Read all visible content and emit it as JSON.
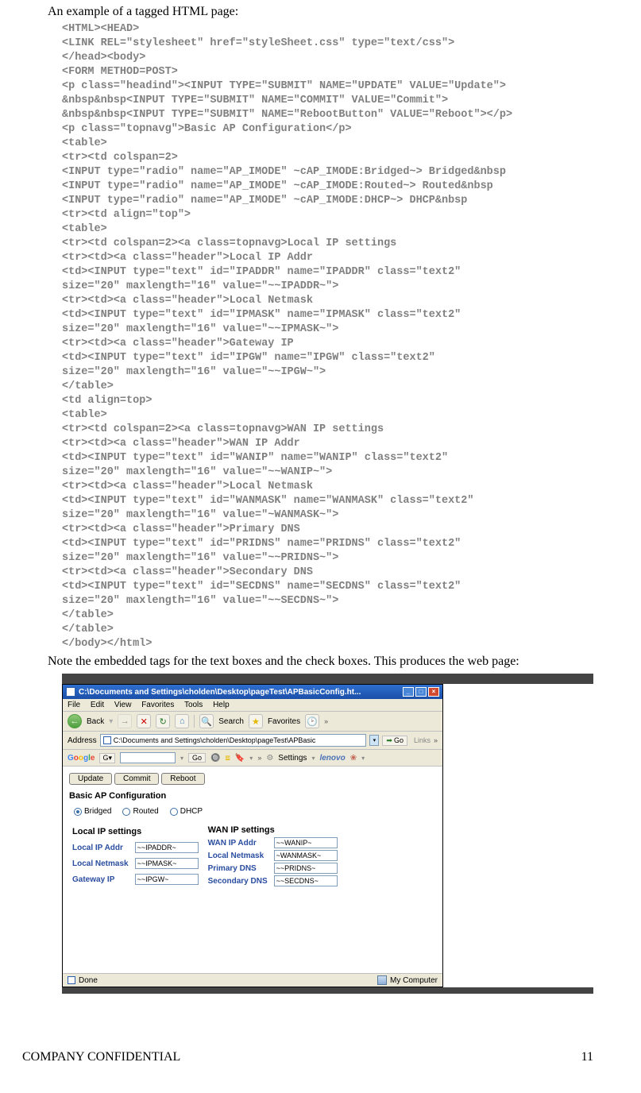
{
  "intro": "An example of a tagged HTML page:",
  "code": "<HTML><HEAD>\n<LINK REL=\"stylesheet\" href=\"styleSheet.css\" type=\"text/css\">\n</head><body>\n<FORM METHOD=POST>\n<p class=\"headind\"><INPUT TYPE=\"SUBMIT\" NAME=\"UPDATE\" VALUE=\"Update\">\n&nbsp&nbsp<INPUT TYPE=\"SUBMIT\" NAME=\"COMMIT\" VALUE=\"Commit\">\n&nbsp&nbsp<INPUT TYPE=\"SUBMIT\" NAME=\"RebootButton\" VALUE=\"Reboot\"></p>\n<p class=\"topnavg\">Basic AP Configuration</p>\n<table>\n<tr><td colspan=2>\n<INPUT type=\"radio\" name=\"AP_IMODE\" ~cAP_IMODE:Bridged~> Bridged&nbsp\n<INPUT type=\"radio\" name=\"AP_IMODE\" ~cAP_IMODE:Routed~> Routed&nbsp\n<INPUT type=\"radio\" name=\"AP_IMODE\" ~cAP_IMODE:DHCP~> DHCP&nbsp\n<tr><td align=\"top\">\n<table>\n<tr><td colspan=2><a class=topnavg>Local IP settings\n<tr><td><a class=\"header\">Local IP Addr\n<td><INPUT type=\"text\" id=\"IPADDR\" name=\"IPADDR\" class=\"text2\"\nsize=\"20\" maxlength=\"16\" value=\"~~IPADDR~\">\n<tr><td><a class=\"header\">Local Netmask\n<td><INPUT type=\"text\" id=\"IPMASK\" name=\"IPMASK\" class=\"text2\"\nsize=\"20\" maxlength=\"16\" value=\"~~IPMASK~\">\n<tr><td><a class=\"header\">Gateway IP\n<td><INPUT type=\"text\" id=\"IPGW\" name=\"IPGW\" class=\"text2\"\nsize=\"20\" maxlength=\"16\" value=\"~~IPGW~\">\n</table>\n<td align=top>\n<table>\n<tr><td colspan=2><a class=topnavg>WAN IP settings\n<tr><td><a class=\"header\">WAN IP Addr\n<td><INPUT type=\"text\" id=\"WANIP\" name=\"WANIP\" class=\"text2\"\nsize=\"20\" maxlength=\"16\" value=\"~~WANIP~\">\n<tr><td><a class=\"header\">Local Netmask\n<td><INPUT type=\"text\" id=\"WANMASK\" name=\"WANMASK\" class=\"text2\"\nsize=\"20\" maxlength=\"16\" value=\"~WANMASK~\">\n<tr><td><a class=\"header\">Primary DNS\n<td><INPUT type=\"text\" id=\"PRIDNS\" name=\"PRIDNS\" class=\"text2\"\nsize=\"20\" maxlength=\"16\" value=\"~~PRIDNS~\">\n<tr><td><a class=\"header\">Secondary DNS\n<td><INPUT type=\"text\" id=\"SECDNS\" name=\"SECDNS\" class=\"text2\"\nsize=\"20\" maxlength=\"16\" value=\"~~SECDNS~\">\n</table>\n</table>\n</body></html>",
  "note": "Note the embedded tags for the text boxes and the check boxes. This produces the web page:",
  "browser": {
    "title": "C:\\Documents and Settings\\cholden\\Desktop\\pageTest\\APBasicConfig.ht...",
    "menu": [
      "File",
      "Edit",
      "View",
      "Favorites",
      "Tools",
      "Help"
    ],
    "toolbar": {
      "back": "Back",
      "search": "Search",
      "favorites": "Favorites"
    },
    "address_label": "Address",
    "address": "C:\\Documents and Settings\\cholden\\Desktop\\pageTest\\APBasic",
    "go": "Go",
    "links": "Links",
    "google": {
      "label": "Google",
      "go": "Go",
      "settings": "Settings",
      "brand": "lenovo"
    },
    "page": {
      "buttons": {
        "update": "Update",
        "commit": "Commit",
        "reboot": "Reboot"
      },
      "heading": "Basic AP Configuration",
      "radios": {
        "bridged": "Bridged",
        "routed": "Routed",
        "dhcp": "DHCP"
      },
      "local": {
        "title": "Local IP settings",
        "rows": [
          {
            "label": "Local IP Addr",
            "value": "~~IPADDR~"
          },
          {
            "label": "Local Netmask",
            "value": "~~IPMASK~"
          },
          {
            "label": "Gateway IP",
            "value": "~~IPGW~"
          }
        ]
      },
      "wan": {
        "title": "WAN IP settings",
        "rows": [
          {
            "label": "WAN IP Addr",
            "value": "~~WANIP~"
          },
          {
            "label": "Local Netmask",
            "value": "~WANMASK~"
          },
          {
            "label": "Primary DNS",
            "value": "~~PRIDNS~"
          },
          {
            "label": "Secondary DNS",
            "value": "~~SECDNS~"
          }
        ]
      }
    },
    "status": {
      "done": "Done",
      "zone": "My Computer"
    }
  },
  "footer": {
    "confidential": "COMPANY CONFIDENTIAL",
    "page": "11"
  }
}
